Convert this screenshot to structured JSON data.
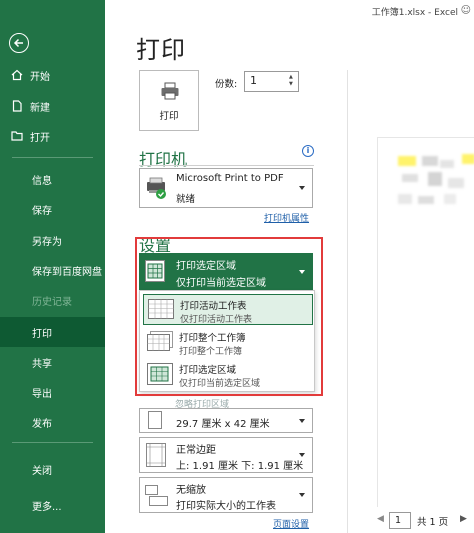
{
  "titlebar": {
    "title": "工作簿1.xlsx  -  Excel"
  },
  "sidebar": {
    "back_icon": "back-arrow-icon",
    "items": [
      {
        "label": "开始",
        "icon": "home-icon"
      },
      {
        "label": "新建",
        "icon": "new-document-icon"
      },
      {
        "label": "打开",
        "icon": "open-folder-icon"
      },
      {
        "label": "信息"
      },
      {
        "label": "保存"
      },
      {
        "label": "另存为"
      },
      {
        "label": "保存到百度网盘"
      },
      {
        "label": "历史记录"
      },
      {
        "label": "打印"
      },
      {
        "label": "共享"
      },
      {
        "label": "导出"
      },
      {
        "label": "发布"
      },
      {
        "label": "关闭"
      },
      {
        "label": "更多..."
      }
    ]
  },
  "main": {
    "title": "打印",
    "print_button": "打印",
    "copies_label": "份数:",
    "copies_value": "1",
    "printer_heading": "打印机",
    "printer": {
      "name": "Microsoft Print to PDF",
      "status": "就绪"
    },
    "printer_props_link": "打印机属性",
    "settings_heading": "设置",
    "print_area": {
      "line1": "打印选定区域",
      "line2": "仅打印当前选定区域"
    },
    "menu": [
      {
        "line1": "打印活动工作表",
        "line2": "仅打印活动工作表",
        "selected": true
      },
      {
        "line1": "打印整个工作簿",
        "line2": "打印整个工作簿",
        "selected": false
      },
      {
        "line1": "打印选定区域",
        "line2": "仅打印当前选定区域",
        "selected": false
      }
    ],
    "faded_text": "忽略打印区域",
    "paper": "29.7 厘米 x 42 厘米",
    "margins": {
      "line1": "正常边距",
      "line2": "上: 1.91 厘米 下: 1.91 厘米"
    },
    "scaling": {
      "line1": "无缩放",
      "line2": "打印实际大小的工作表"
    },
    "page_setup_link": "页面设置"
  },
  "preview": {
    "page": "1",
    "total": "共 1 页"
  },
  "colors": {
    "accent": "#217346",
    "highlight": "#e23b3b"
  }
}
